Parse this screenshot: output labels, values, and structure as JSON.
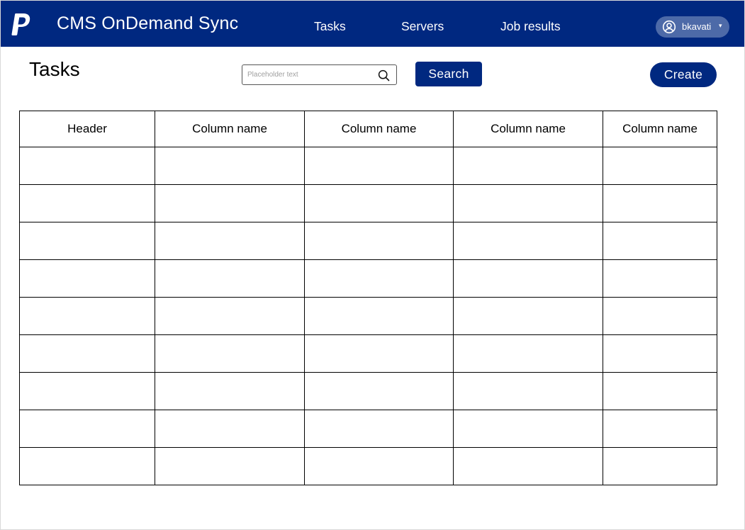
{
  "header": {
    "app_title": "CMS OnDemand Sync",
    "logo_icon": "paypal-logo",
    "nav": {
      "tasks": "Tasks",
      "servers": "Servers",
      "job_results": "Job results"
    },
    "user": {
      "name": "bkavati",
      "caret": "▾",
      "icon": "user-circle-icon"
    }
  },
  "toolbar": {
    "page_title": "Tasks",
    "search": {
      "placeholder": "Placeholder text",
      "value": "",
      "icon": "search-icon"
    },
    "search_button": "Search",
    "create_button": "Create"
  },
  "table": {
    "columns": [
      "Header",
      "Column name",
      "Column name",
      "Column name",
      "Column name"
    ],
    "row_count": 9
  },
  "colors": {
    "brand": "#002880",
    "user_pill": "#4d6aa8"
  }
}
